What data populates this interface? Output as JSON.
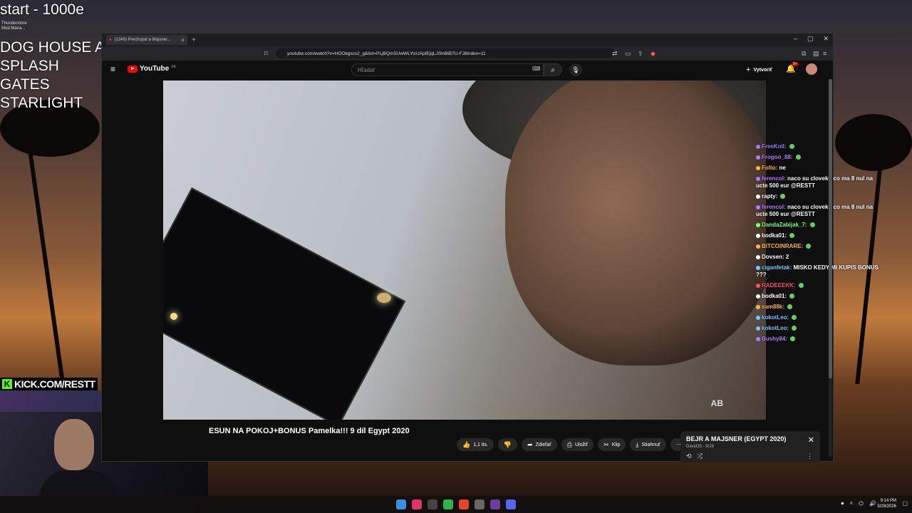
{
  "overlay": {
    "title": "start - 1000e",
    "app_label_line1": "Thunderstore",
    "app_label_line2": "Mod Mana...",
    "list": [
      "DOG HOUSE ALIVE",
      "SPLASH",
      "GATES",
      "STARLIGHT"
    ]
  },
  "stream": {
    "kick_icon": "K",
    "kick_url": "KICK.COM/RESTT"
  },
  "browser": {
    "tab_title": "(1249) Prechopat a Majsner...",
    "tab_close": "×",
    "new_tab": "+",
    "url": "youtube.com/watch?v=HOOkgscs2_g&list=PLjBQmSUwWLYicUAptEjqLJSlnBiB7U-FJ8index=11",
    "window_controls": [
      "–",
      "▢",
      "✕"
    ]
  },
  "youtube": {
    "logo_text": "YouTube",
    "logo_region": "SK",
    "search_placeholder": "Hľadať",
    "create_label": "Vytvoriť",
    "notification_count": "9+",
    "video_title": "ESUN NA POKOJ+BONUS Pamelka!!! 9 díl Egypt 2020",
    "watermark": "AB",
    "actions": {
      "likes": "1,1 tis.",
      "share": "Zdieľať",
      "save": "Uložiť",
      "clip": "Klip",
      "download": "Stiahnuť",
      "more": "⋯"
    },
    "playlist": {
      "title": "BEJR A MAJSNER (EGYPT 2020)",
      "subtitle": "David35 - 9/26",
      "close": "✕",
      "more": "⋮"
    }
  },
  "chat": [
    {
      "user": "FreeKnil:",
      "text": "",
      "color": "#9b7bff"
    },
    {
      "user": "Frogoo_88:",
      "text": "",
      "color": "#b07bff"
    },
    {
      "user": "Folto:",
      "text": "ne",
      "color": "#ffb347"
    },
    {
      "user": "ferencol:",
      "text": "naco su cloveku co ma 8 nul na ucte 500 eur @RESTT",
      "color": "#b07bff"
    },
    {
      "user": "rapty:",
      "text": "",
      "color": "#ffffff"
    },
    {
      "user": "ferencol:",
      "text": "naco su cloveku co ma 8 nul na ucte 500 eur @RESTT",
      "color": "#b07bff"
    },
    {
      "user": "DandaZabijak_7:",
      "text": "",
      "color": "#7bff7b"
    },
    {
      "user": "bodka01:",
      "text": "",
      "color": "#ffffff"
    },
    {
      "user": "BITCOINRARE:",
      "text": "",
      "color": "#ffb347"
    },
    {
      "user": "Dovsen:",
      "text": "2",
      "color": "#ffffff"
    },
    {
      "user": "ciganfetak:",
      "text": "MISKO KEDY MI KUPIS BONUS ???",
      "color": "#7bc8ff"
    },
    {
      "user": "RADEEEKK:",
      "text": "",
      "color": "#ff4d6a"
    },
    {
      "user": "bodka01:",
      "text": "",
      "color": "#ffffff"
    },
    {
      "user": "sam88k:",
      "text": "",
      "color": "#ffb347"
    },
    {
      "user": "kokotLeo:",
      "text": "",
      "color": "#7bc8ff"
    },
    {
      "user": "kokotLeo:",
      "text": "",
      "color": "#7bc8ff"
    },
    {
      "user": "Bushy84:",
      "text": "",
      "color": "#b07bff"
    }
  ],
  "taskbar": {
    "time": "9:14 PM",
    "date": "3/29/2026"
  }
}
